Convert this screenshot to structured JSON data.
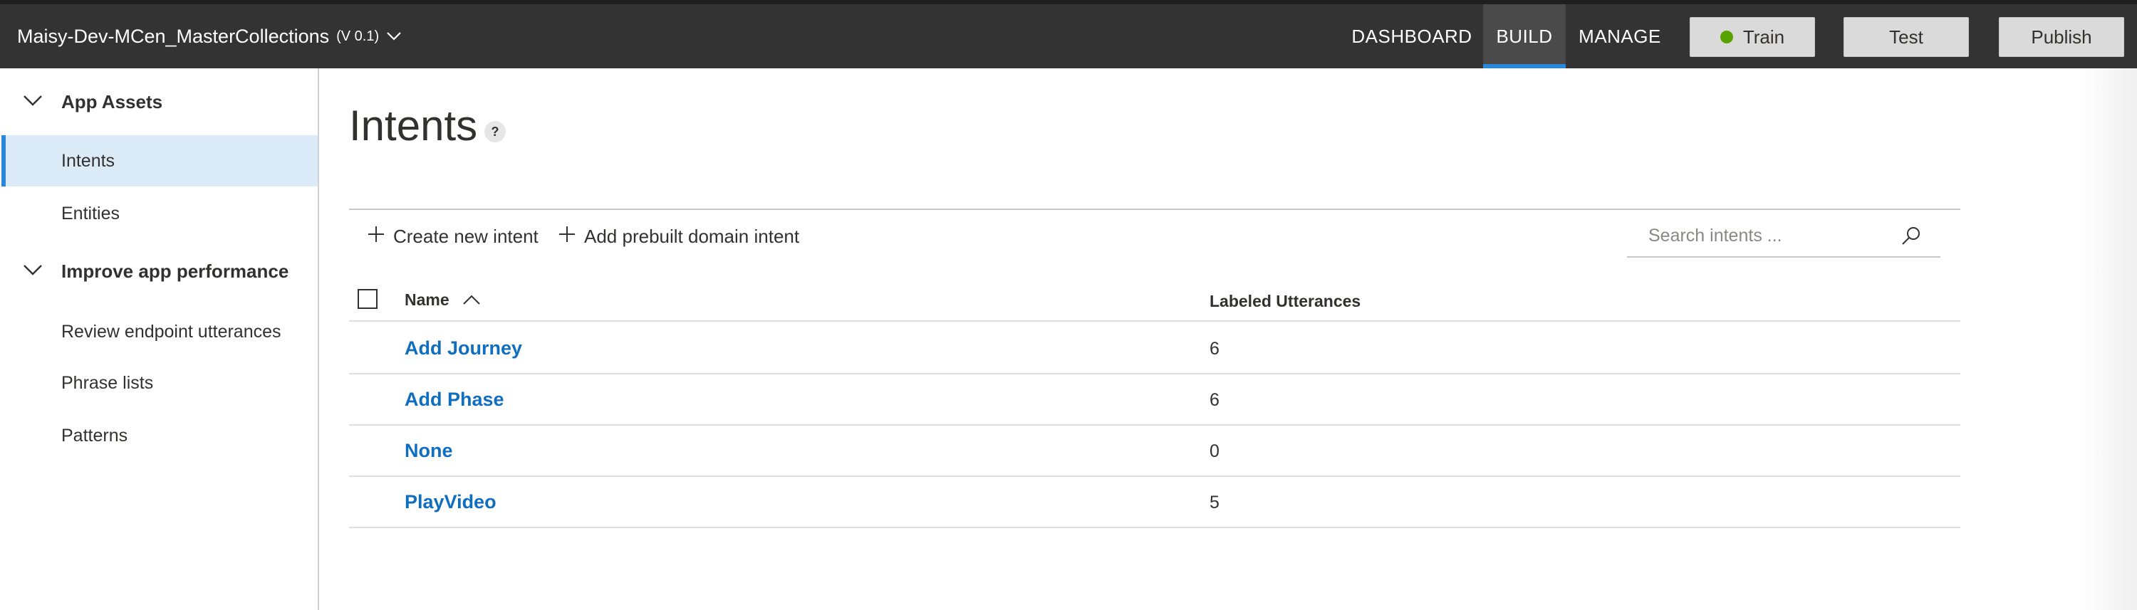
{
  "header": {
    "app_name": "Maisy-Dev-MCen_MasterCollections",
    "version": "(V 0.1)",
    "nav": [
      {
        "label": "DASHBOARD",
        "active": false
      },
      {
        "label": "BUILD",
        "active": true
      },
      {
        "label": "MANAGE",
        "active": false
      }
    ],
    "buttons": {
      "train": "Train",
      "test": "Test",
      "publish": "Publish"
    },
    "train_status_color": "#57a300",
    "accent_color": "#2b88d8"
  },
  "sidebar": {
    "groups": [
      {
        "label": "App Assets",
        "expanded": true,
        "items": [
          {
            "label": "Intents",
            "selected": true
          },
          {
            "label": "Entities",
            "selected": false
          }
        ]
      },
      {
        "label": "Improve app performance",
        "expanded": true,
        "items": [
          {
            "label": "Review endpoint utterances",
            "selected": false
          },
          {
            "label": "Phrase lists",
            "selected": false
          },
          {
            "label": "Patterns",
            "selected": false
          }
        ]
      }
    ]
  },
  "main": {
    "title": "Intents",
    "help": "?",
    "commands": {
      "create": "Create new intent",
      "prebuilt": "Add prebuilt domain intent"
    },
    "search_placeholder": "Search intents ...",
    "table": {
      "columns": [
        "Name",
        "Labeled Utterances"
      ],
      "sort": "Name ascending",
      "rows": [
        {
          "name": "Add Journey",
          "utterances": "6"
        },
        {
          "name": "Add Phase",
          "utterances": "6"
        },
        {
          "name": "None",
          "utterances": "0"
        },
        {
          "name": "PlayVideo",
          "utterances": "5"
        }
      ]
    }
  },
  "icons": [
    "chevron-down-icon",
    "plus-icon",
    "search-icon",
    "sort-ascending-icon",
    "status-dot-icon",
    "help-icon"
  ]
}
